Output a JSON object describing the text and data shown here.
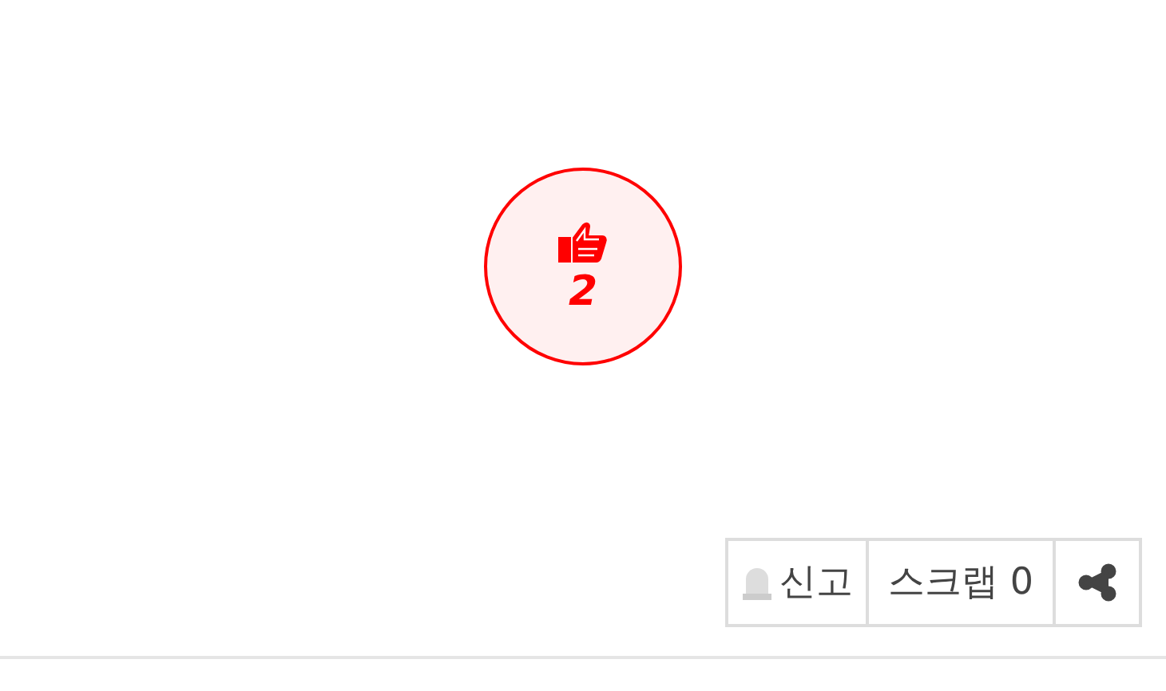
{
  "like": {
    "count": "2"
  },
  "actions": [
    {
      "kind": "report",
      "label": "신고"
    },
    {
      "kind": "scrap",
      "label": "스크랩 0"
    },
    {
      "kind": "share"
    }
  ]
}
